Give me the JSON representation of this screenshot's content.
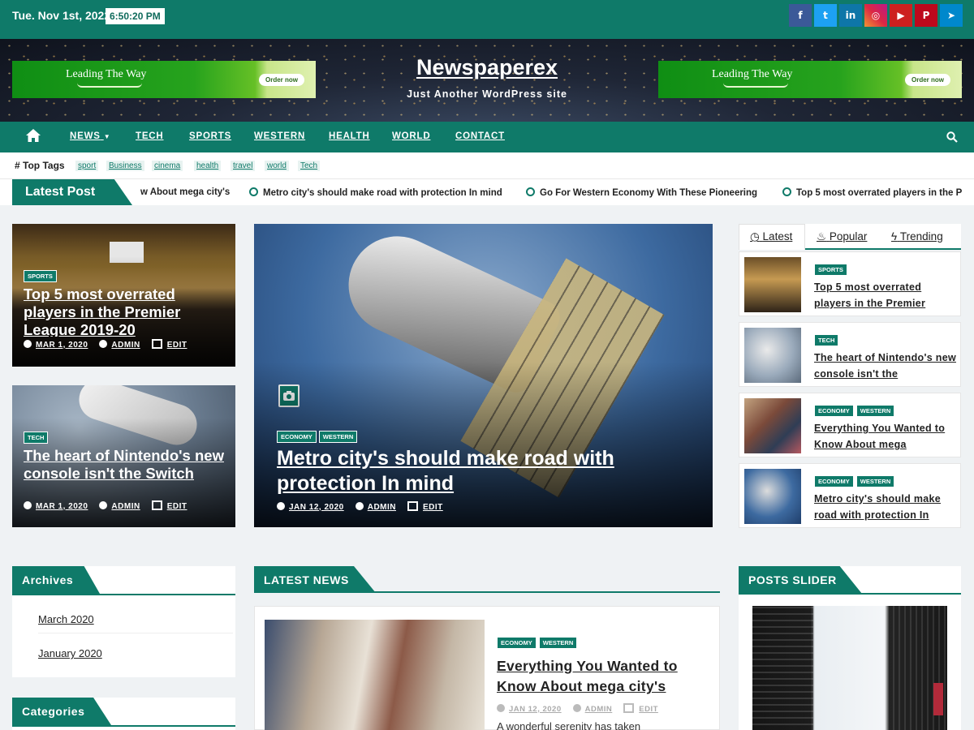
{
  "topbar": {
    "date": "Tue. Nov 1st, 2022",
    "time": "6:50:20 PM"
  },
  "social": [
    {
      "icon": "facebook-icon",
      "glyph": "f",
      "color": "#3b5998"
    },
    {
      "icon": "twitter-icon",
      "glyph": "t",
      "color": "#1da1f2"
    },
    {
      "icon": "linkedin-icon",
      "glyph": "in",
      "color": "#0e76a8"
    },
    {
      "icon": "instagram-icon",
      "glyph": "◎",
      "color": "#d6249f"
    },
    {
      "icon": "youtube-icon",
      "glyph": "▶",
      "color": "#cd201f"
    },
    {
      "icon": "pinterest-icon",
      "glyph": "P",
      "color": "#bd081c"
    },
    {
      "icon": "telegram-icon",
      "glyph": "➤",
      "color": "#0088cc"
    }
  ],
  "header": {
    "site_name": "Newspaperex",
    "tagline": "Just Another WordPress site",
    "ad_left": {
      "text": "Leading The Way",
      "button": "Order now"
    },
    "ad_right": {
      "text": "Leading The Way",
      "button": "Order now"
    }
  },
  "nav": {
    "items": [
      "NEWS",
      "TECH",
      "SPORTS",
      "WESTERN",
      "HEALTH",
      "WORLD",
      "CONTACT"
    ]
  },
  "top_tags": {
    "label": "Top Tags",
    "items": [
      "sport",
      "Business",
      "cinema",
      "health",
      "travel",
      "world",
      "Tech"
    ]
  },
  "ticker": {
    "label": "Latest Post",
    "items": [
      "w About mega city's",
      "Metro city's should make road with protection In mind",
      "Go For Western Economy With These Pioneering",
      "Top 5 most overrated players in the P"
    ]
  },
  "featured": {
    "left_top": {
      "categories": [
        "SPORTS"
      ],
      "title": "Top 5 most overrated players in the Premier League 2019-20",
      "date": "MAR 1, 2020",
      "author": "ADMIN",
      "edit": "EDIT"
    },
    "left_bottom": {
      "categories": [
        "TECH"
      ],
      "title": "The heart of Nintendo's new console isn't the Switch",
      "date": "MAR 1, 2020",
      "author": "ADMIN",
      "edit": "EDIT"
    },
    "main": {
      "categories": [
        "ECONOMY",
        "WESTERN"
      ],
      "title": "Metro city's should make road with protection In mind",
      "date": "JAN 12, 2020",
      "author": "ADMIN",
      "edit": "EDIT"
    }
  },
  "side_tabs": {
    "tabs": [
      "Latest",
      "Popular",
      "Trending"
    ],
    "posts": [
      {
        "categories": [
          "SPORTS"
        ],
        "title": "Top 5 most overrated players in the Premier"
      },
      {
        "categories": [
          "TECH"
        ],
        "title": "The heart of Nintendo's new console isn't the"
      },
      {
        "categories": [
          "ECONOMY",
          "WESTERN"
        ],
        "title": "Everything You Wanted to Know About mega"
      },
      {
        "categories": [
          "ECONOMY",
          "WESTERN"
        ],
        "title": "Metro city's should make road with protection In"
      }
    ]
  },
  "archives": {
    "title": "Archives",
    "items": [
      "March 2020",
      "January 2020"
    ]
  },
  "categories": {
    "title": "Categories"
  },
  "latest_news": {
    "title": "LATEST NEWS",
    "post": {
      "categories": [
        "ECONOMY",
        "WESTERN"
      ],
      "title": "Everything You Wanted to Know About mega city's",
      "date": "JAN 12, 2020",
      "author": "ADMIN",
      "edit": "EDIT",
      "excerpt": "A wonderful serenity has taken"
    }
  },
  "posts_slider": {
    "title": "POSTS SLIDER"
  },
  "colors": {
    "primary": "#0f7a69",
    "background": "#eff2f4"
  }
}
